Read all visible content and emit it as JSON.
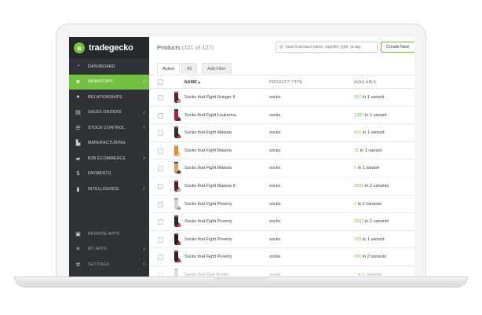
{
  "brand": {
    "name": "tradegecko",
    "accent": "#74c043",
    "warning": "#f0a30a"
  },
  "sidebar": {
    "items": [
      {
        "label": "DASHBOARD",
        "icon": "dashboard-icon",
        "chevron": false,
        "active": false
      },
      {
        "label": "INVENTORY",
        "icon": "box-icon",
        "chevron": true,
        "active": true
      },
      {
        "label": "RELATIONSHIPS",
        "icon": "person-icon",
        "chevron": false,
        "active": false
      },
      {
        "label": "SALES ORDERS",
        "icon": "clipboard-icon",
        "chevron": true,
        "active": false
      },
      {
        "label": "STOCK CONTROL",
        "icon": "sliders-icon",
        "chevron": true,
        "active": false
      },
      {
        "label": "MANUFACTURING",
        "icon": "factory-icon",
        "chevron": false,
        "active": false
      },
      {
        "label": "B2B ECOMMERCE",
        "icon": "truck-icon",
        "chevron": true,
        "active": false
      },
      {
        "label": "PAYMENTS",
        "icon": "dollar-icon",
        "chevron": false,
        "active": false
      },
      {
        "label": "INTELLIGENCE",
        "icon": "bar-chart-icon",
        "chevron": true,
        "active": false
      }
    ],
    "bottom_items": [
      {
        "label": "BROWSE APPS",
        "icon": "apps-icon",
        "chevron": false
      },
      {
        "label": "MY APPS",
        "icon": "tools-icon",
        "chevron": true
      },
      {
        "label": "SETTINGS",
        "icon": "gear-icon",
        "chevron": true
      }
    ]
  },
  "header": {
    "title": "Products",
    "count": "(101 of 127)",
    "search_placeholder": "Search product name, supplier, type, or tag",
    "create_label": "Create New"
  },
  "tabs": [
    {
      "label": "Active",
      "active": true
    },
    {
      "label": "All",
      "active": false
    }
  ],
  "filter_label": "Add Filter",
  "table": {
    "headers": {
      "name": "NAME",
      "type": "PRODUCT TYPE",
      "available": "AVAILABLE"
    },
    "rows": [
      {
        "name": "Socks that Fight Hunger II",
        "type": "socks",
        "qty": "557",
        "variants": "in 1 variant",
        "status": "green"
      },
      {
        "name": "Socks that Fight Leukemia",
        "type": "socks",
        "qty": "1383",
        "variants": "in 1 variant",
        "status": "green"
      },
      {
        "name": "Socks that Fight Malaria",
        "type": "socks",
        "qty": "471",
        "variants": "in 1 variant",
        "status": "green"
      },
      {
        "name": "Socks that Fight Malaria",
        "type": "socks",
        "qty": "31",
        "variants": "in 1 variant",
        "status": "green"
      },
      {
        "name": "Socks that Fight Malaria",
        "type": "socks",
        "qty": "0",
        "variants": "in 1 variant",
        "status": "orange"
      },
      {
        "name": "Socks that Fight Malaria II",
        "type": "socks",
        "qty": "3022",
        "variants": "in 2 variants",
        "status": "green"
      },
      {
        "name": "Socks that Fight Poverty",
        "type": "socks",
        "qty": "0",
        "variants": "in 2 variants",
        "status": "orange"
      },
      {
        "name": "Socks that Fight Poverty",
        "type": "socks",
        "qty": "2593",
        "variants": "in 2 variants",
        "status": "green"
      },
      {
        "name": "Socks that Fight Poverty",
        "type": "socks",
        "qty": "329",
        "variants": "in 1 variant",
        "status": "green"
      },
      {
        "name": "Socks that Fight Poverty",
        "type": "socks",
        "qty": "436",
        "variants": "in 2 variants",
        "status": "green"
      },
      {
        "name": "Socks that Give Books",
        "type": "socks",
        "qty": "0",
        "variants": "in 2 variants",
        "status": "orange"
      }
    ]
  }
}
